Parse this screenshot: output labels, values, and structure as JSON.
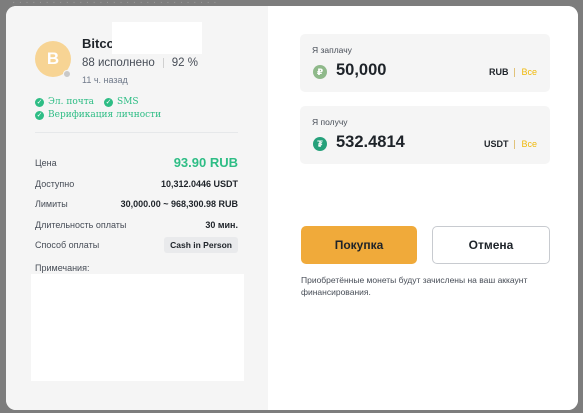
{
  "backdrop": {
    "text": "· · ·    · · · · · · · · · ·    · · · · · ·    · · · · · ·    · · · · · ·"
  },
  "trader": {
    "avatar_letter": "B",
    "name": "Bitco",
    "orders_completed": "88 исполнено",
    "completion_rate": "92 %",
    "last_seen": "11 ч. назад"
  },
  "verifications": {
    "email": "Эл. почта",
    "sms": "SMS",
    "identity": "Верификация личности"
  },
  "offer": {
    "price_label": "Цена",
    "price_value": "93.90 RUB",
    "available_label": "Доступно",
    "available_value": "10,312.0446 USDT",
    "limits_label": "Лимиты",
    "limits_value": "30,000.00 ~ 968,300.98 RUB",
    "duration_label": "Длительность оплаты",
    "duration_value": "30 мин.",
    "method_label": "Способ оплаты",
    "method_value": "Cash in Person",
    "notes_label": "Примечания:"
  },
  "pay": {
    "label": "Я заплачу",
    "amount": "50,000",
    "currency": "RUB",
    "all_label": "Все",
    "icon_glyph": "₽"
  },
  "receive": {
    "label": "Я получу",
    "amount": "532.4814",
    "currency": "USDT",
    "all_label": "Все",
    "icon_glyph": "₮"
  },
  "actions": {
    "buy_label": "Покупка",
    "cancel_label": "Отмена"
  },
  "footnote": "Приобретённые монеты будут зачислены на ваш аккаунт финансирования.",
  "colors": {
    "accent": "#f0aa3a",
    "success": "#2ebd85",
    "link": "#f0b90b"
  }
}
